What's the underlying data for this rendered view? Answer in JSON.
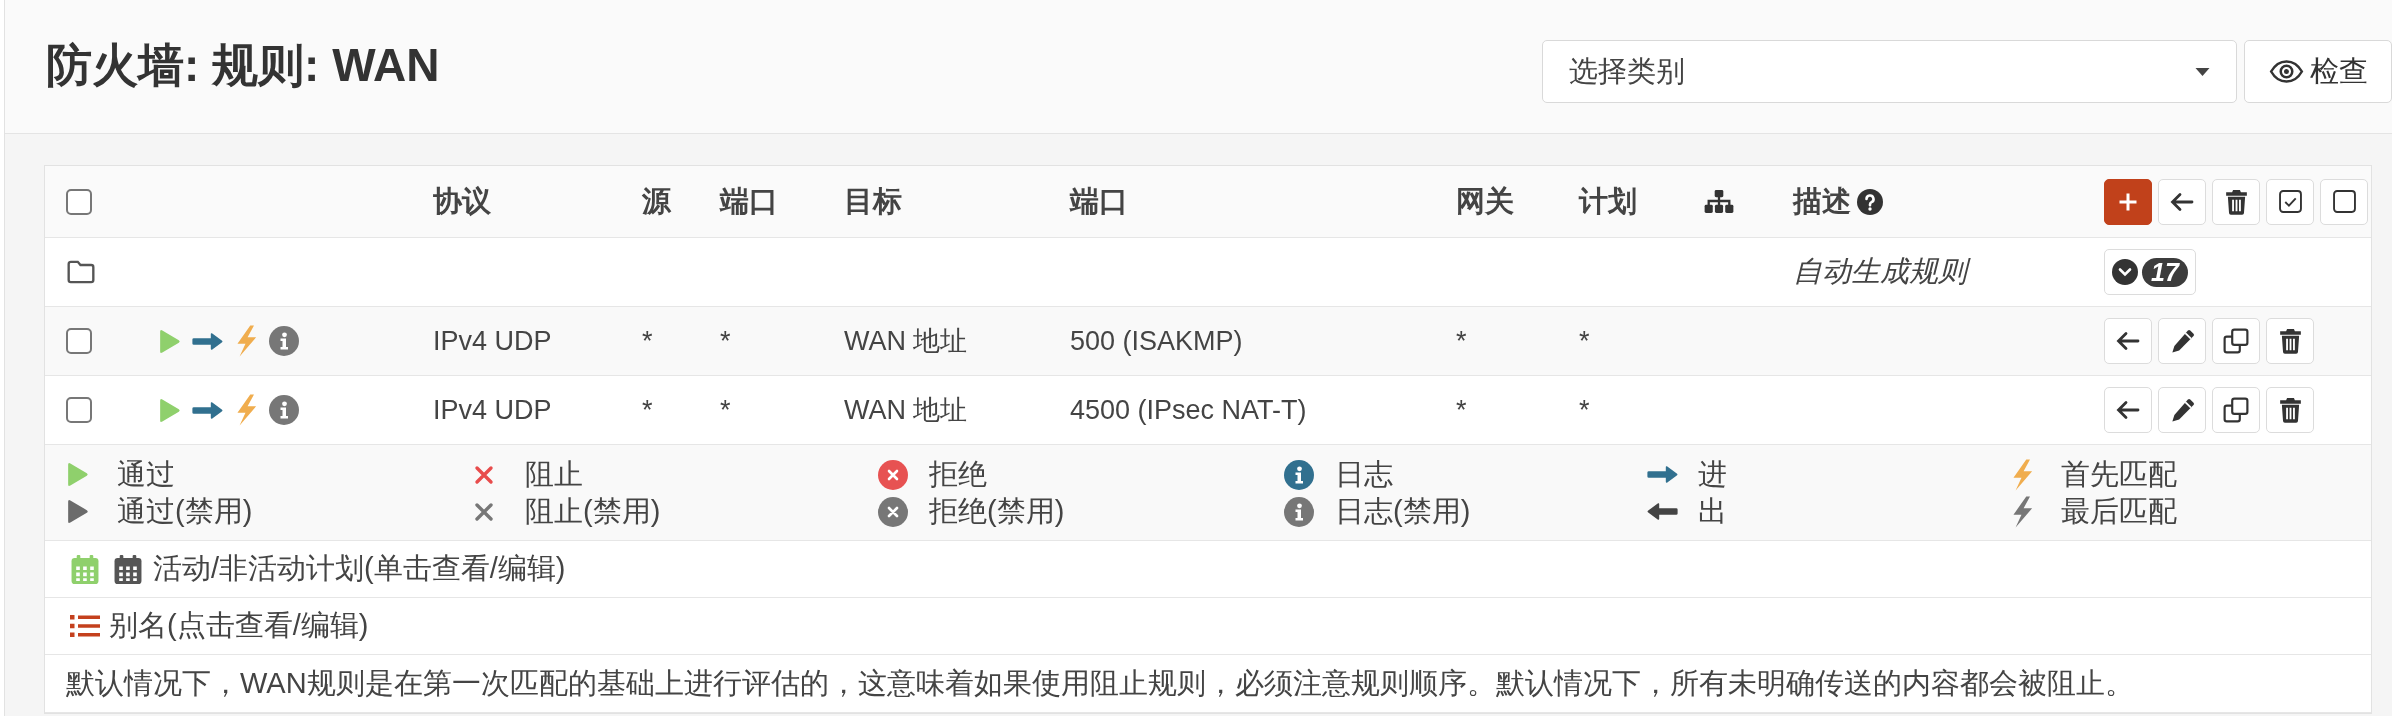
{
  "page_title": "防火墙: 规则: WAN",
  "category_select": {
    "value": "选择类别"
  },
  "inspect_button": {
    "label": "检查"
  },
  "table": {
    "select_all": {
      "checked": false
    },
    "columns": [
      {
        "kind": "text",
        "label": "协议"
      },
      {
        "kind": "text",
        "label": "源"
      },
      {
        "kind": "text",
        "label": "端口"
      },
      {
        "kind": "text",
        "label": "目标"
      },
      {
        "kind": "text",
        "label": "端口"
      },
      {
        "kind": "text",
        "label": "网关"
      },
      {
        "kind": "text",
        "label": "计划"
      },
      {
        "kind": "icon"
      },
      {
        "kind": "help",
        "label": "描述"
      }
    ],
    "group": {
      "description": "自动生成规则",
      "count": "17"
    },
    "rows": [
      {
        "checked": false,
        "icons": [
          {
            "kind": "pass"
          },
          {
            "kind": "in"
          },
          {
            "kind": "first_match"
          },
          {
            "kind": "log_disabled"
          }
        ],
        "protocol": "IPv4 UDP",
        "source": "*",
        "source_port": "*",
        "destination": "WAN 地址",
        "destination_port": "500 (ISAKMP)",
        "gateway": "*",
        "schedule": "*"
      },
      {
        "checked": false,
        "icons": [
          {
            "kind": "pass"
          },
          {
            "kind": "in"
          },
          {
            "kind": "first_match"
          },
          {
            "kind": "log_disabled"
          }
        ],
        "protocol": "IPv4 UDP",
        "source": "*",
        "source_port": "*",
        "destination": "WAN 地址",
        "destination_port": "4500 (IPsec NAT-T)",
        "gateway": "*",
        "schedule": "*"
      }
    ]
  },
  "legend": [
    {
      "entries": [
        {
          "kind": "pass",
          "label": "通过"
        },
        {
          "kind": "pass_disabled",
          "label": "通过(禁用)"
        }
      ]
    },
    {
      "entries": [
        {
          "kind": "block",
          "label": "阻止"
        },
        {
          "kind": "block_disabled",
          "label": "阻止(禁用)"
        }
      ]
    },
    {
      "entries": [
        {
          "kind": "reject",
          "label": "拒绝"
        },
        {
          "kind": "reject_disabled",
          "label": "拒绝(禁用)"
        }
      ]
    },
    {
      "entries": [
        {
          "kind": "log",
          "label": "日志"
        },
        {
          "kind": "log_disabled",
          "label": "日志(禁用)"
        }
      ]
    },
    {
      "entries": [
        {
          "kind": "in",
          "label": "进"
        },
        {
          "kind": "out",
          "label": "出"
        }
      ]
    },
    {
      "entries": [
        {
          "kind": "first_match",
          "label": "首先匹配"
        },
        {
          "kind": "last_match",
          "label": "最后匹配"
        }
      ]
    }
  ],
  "schedule_note": "活动/非活动计划(单击查看/编辑)",
  "alias_note": "别名(点击查看/编辑)",
  "info_text": "默认情况下，WAN规则是在第一次匹配的基础上进行评估的，这意味着如果使用阻止规则，必须注意规则顺序。默认情况下，所有未明确传送的内容都会被阻止。"
}
